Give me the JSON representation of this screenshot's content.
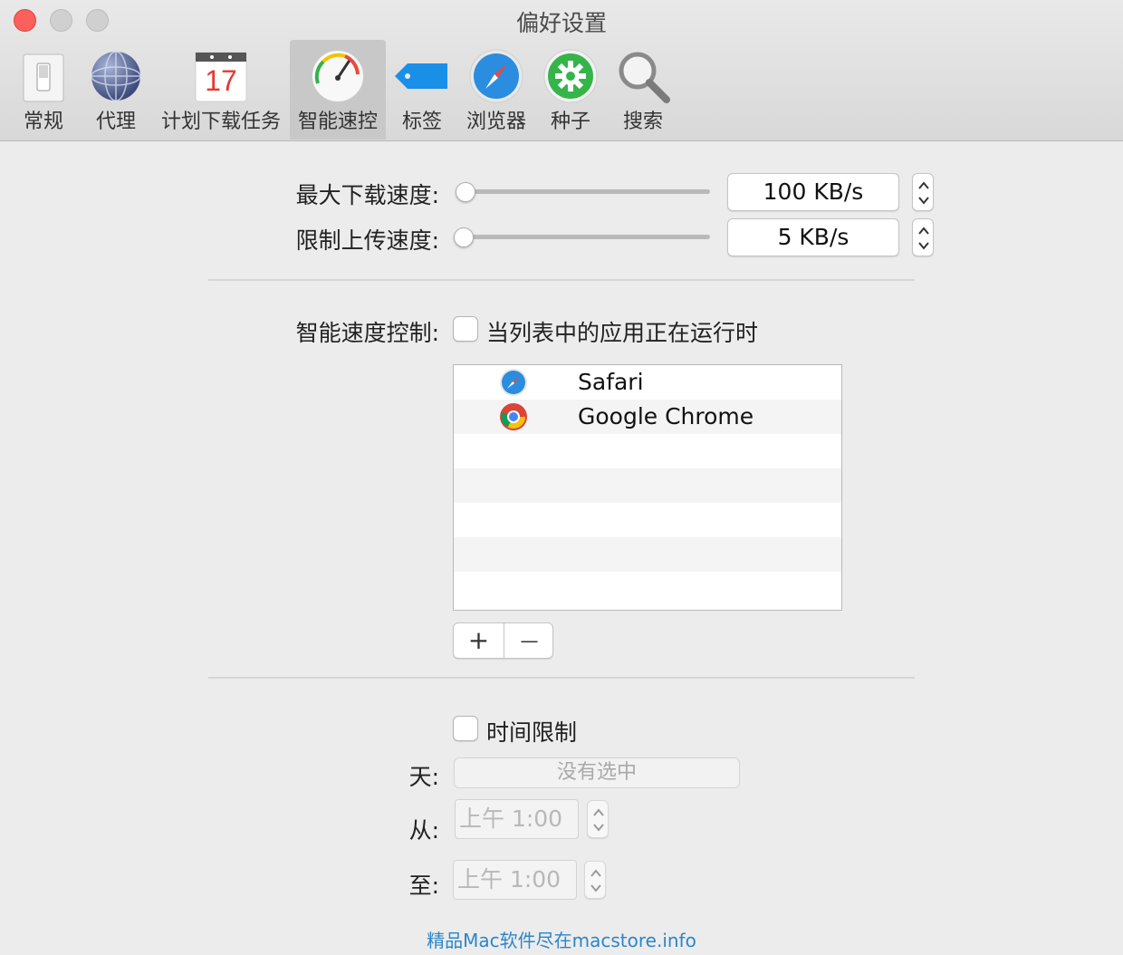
{
  "window": {
    "title": "偏好设置"
  },
  "toolbar": {
    "items": [
      {
        "label": "常规",
        "icon": "switch-icon"
      },
      {
        "label": "代理",
        "icon": "globe-icon"
      },
      {
        "label": "计划下载任务",
        "icon": "calendar-icon",
        "calendar_day": "17"
      },
      {
        "label": "智能速控",
        "icon": "speedometer-icon",
        "selected": true
      },
      {
        "label": "标签",
        "icon": "tag-icon"
      },
      {
        "label": "浏览器",
        "icon": "compass-icon"
      },
      {
        "label": "种子",
        "icon": "gear-seed-icon"
      },
      {
        "label": "搜索",
        "icon": "magnifier-icon"
      }
    ]
  },
  "speed": {
    "max_download_label": "最大下载速度:",
    "max_download_value": "100 KB/s",
    "upload_limit_label": "限制上传速度:",
    "upload_limit_value": "5 KB/s"
  },
  "smart": {
    "label": "智能速度控制:",
    "checkbox_label": "当列表中的应用正在运行时",
    "checked": false,
    "apps": [
      {
        "name": "Safari",
        "icon": "safari-icon"
      },
      {
        "name": "Google Chrome",
        "icon": "chrome-icon"
      }
    ],
    "add_label": "+",
    "remove_label": "—"
  },
  "time_limit": {
    "checkbox_label": "时间限制",
    "checked": false,
    "day_label": "天:",
    "day_value": "没有选中",
    "from_label": "从:",
    "from_value": "上午  1:00",
    "to_label": "至:",
    "to_value": "上午  1:00"
  },
  "footer": {
    "watermark": "精品Mac软件尽在macstore.info"
  },
  "colors": {
    "accent": "#2c86c9",
    "close": "#fc605c",
    "tag_blue": "#1a8fe8",
    "seed_green": "#35b44a"
  }
}
